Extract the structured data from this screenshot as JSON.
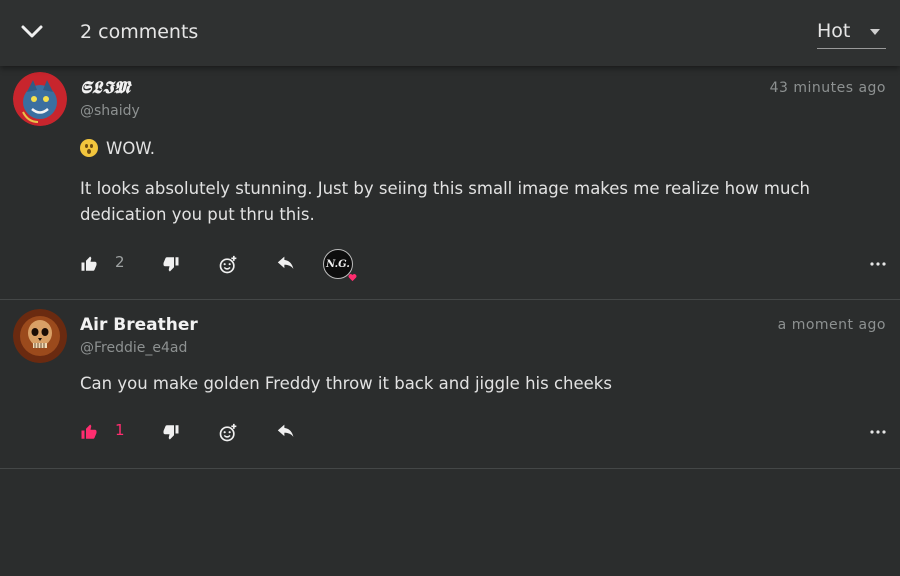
{
  "header": {
    "comment_count_label": "2 comments",
    "sort": {
      "selected": "Hot"
    }
  },
  "colors": {
    "accent_pink": "#ff2d6f",
    "muted": "#8d9191",
    "background": "#2b2d2d"
  },
  "comments": [
    {
      "display_name": "𝕾𝕷𝕴𝕸",
      "handle": "@shaidy",
      "time": "43 minutes ago",
      "avatar_icon": "demon-avatar-icon",
      "emoji_icon": "astonished-face-emoji",
      "lines": [
        "WOW.",
        "It looks absolutely stunning. Just by seiing this small image makes me realize how much dedication you put thru this."
      ],
      "likes": "2",
      "liked": false,
      "reaction_user_initials": "N.G."
    },
    {
      "display_name": "Air Breather",
      "handle": "@Freddie_e4ad",
      "time": "a moment ago",
      "avatar_icon": "skull-avatar-icon",
      "lines": [
        "Can you make golden Freddy throw it back and jiggle his cheeks"
      ],
      "likes": "1",
      "liked": true
    }
  ]
}
